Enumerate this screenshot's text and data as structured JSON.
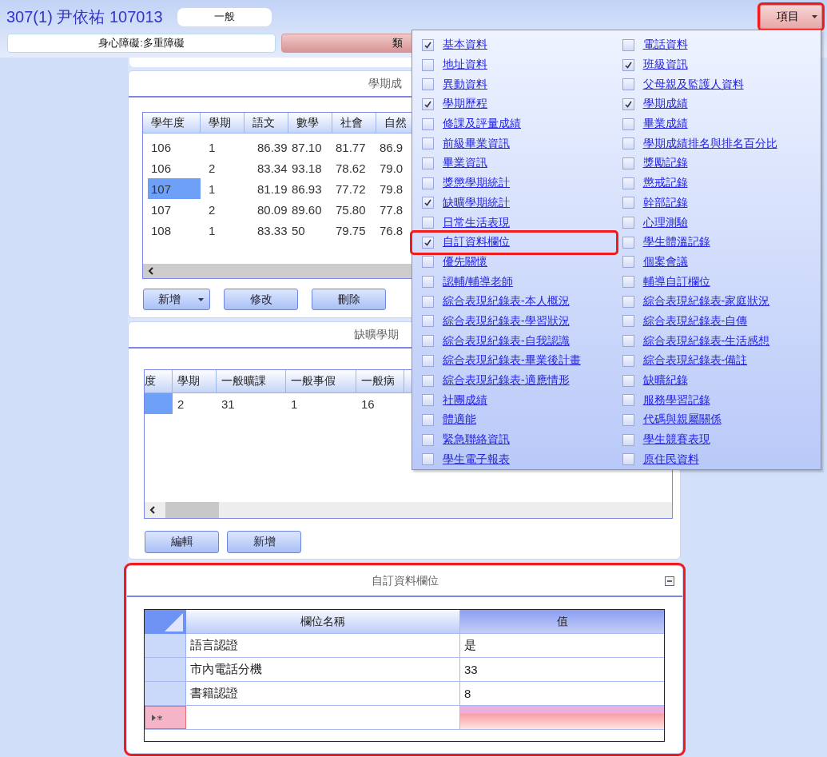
{
  "header": {
    "title": "307(1) 尹依祐 107013",
    "status_button": "一般",
    "disability_field": "身心障礙:多重障礙",
    "category_button": "類",
    "items_button": {
      "label": "項目",
      "highlighted": true
    }
  },
  "panels": [
    {
      "kind": "grid-table",
      "title": "學期成",
      "highlighted": false,
      "columns": [
        "學年度",
        "學期",
        "語文",
        "數學",
        "社會",
        "自然"
      ],
      "rows": [
        {
          "cells": [
            "106",
            "1",
            "86.39",
            "87.10",
            "81.77",
            "86.9"
          ],
          "selected": false
        },
        {
          "cells": [
            "106",
            "2",
            "83.34",
            "93.18",
            "78.62",
            "79.0"
          ],
          "selected": false
        },
        {
          "cells": [
            "107",
            "1",
            "81.19",
            "86.93",
            "77.72",
            "79.8"
          ],
          "selected": true
        },
        {
          "cells": [
            "107",
            "2",
            "80.09",
            "89.60",
            "75.80",
            "77.8"
          ],
          "selected": false
        },
        {
          "cells": [
            "108",
            "1",
            "83.33",
            "50",
            "79.75",
            "76.8"
          ],
          "selected": false
        }
      ],
      "buttons": [
        {
          "label": "新增",
          "dropdown": true
        },
        {
          "label": "修改",
          "dropdown": false
        },
        {
          "label": "刪除",
          "dropdown": false
        }
      ]
    },
    {
      "kind": "grid-table",
      "title": "缺曠學期",
      "highlighted": false,
      "columns": [
        "度",
        "學期",
        "一般曠課",
        "一般事假",
        "一般病"
      ],
      "rows": [
        {
          "cells": [
            "",
            "2",
            "31",
            "1",
            "16"
          ],
          "selected": true
        }
      ],
      "buttons": [
        {
          "label": "編輯",
          "dropdown": false
        },
        {
          "label": "新增",
          "dropdown": false
        }
      ]
    },
    {
      "kind": "field-grid",
      "title": "自訂資料欄位",
      "highlighted": true,
      "collapsible": true,
      "columns": [
        {
          "label": "欄位名稱",
          "selected": false
        },
        {
          "label": "值",
          "selected": true
        }
      ],
      "rows": [
        {
          "cells": [
            "語言認證",
            "是"
          ]
        },
        {
          "cells": [
            "市內電話分機",
            "33"
          ]
        },
        {
          "cells": [
            "書籍認證",
            "8"
          ]
        }
      ],
      "new_row": true
    }
  ],
  "menu": {
    "columns": [
      [
        {
          "label": "基本資料",
          "checked": true,
          "highlighted": false
        },
        {
          "label": "地址資料",
          "checked": false,
          "highlighted": false
        },
        {
          "label": "異動資料",
          "checked": false,
          "highlighted": false
        },
        {
          "label": "學期歷程",
          "checked": true,
          "highlighted": false
        },
        {
          "label": "修課及評量成績",
          "checked": false,
          "highlighted": false
        },
        {
          "label": "前級畢業資訊",
          "checked": false,
          "highlighted": false
        },
        {
          "label": "畢業資訊",
          "checked": false,
          "highlighted": false
        },
        {
          "label": "獎懲學期統計",
          "checked": false,
          "highlighted": false
        },
        {
          "label": "缺曠學期統計",
          "checked": true,
          "highlighted": false
        },
        {
          "label": "日常生活表現",
          "checked": false,
          "highlighted": false
        },
        {
          "label": "自訂資料欄位",
          "checked": true,
          "highlighted": true
        },
        {
          "label": "優先關懷",
          "checked": false,
          "highlighted": false
        },
        {
          "label": "認輔/輔導老師",
          "checked": false,
          "highlighted": false
        },
        {
          "label": "綜合表現紀錄表-本人概況",
          "checked": false,
          "highlighted": false
        },
        {
          "label": "綜合表現紀錄表-學習狀況",
          "checked": false,
          "highlighted": false
        },
        {
          "label": "綜合表現紀錄表-自我認識",
          "checked": false,
          "highlighted": false
        },
        {
          "label": "綜合表現紀錄表-畢業後計畫",
          "checked": false,
          "highlighted": false
        },
        {
          "label": "綜合表現紀錄表-適應情形",
          "checked": false,
          "highlighted": false
        },
        {
          "label": "社團成績",
          "checked": false,
          "highlighted": false
        },
        {
          "label": "體適能",
          "checked": false,
          "highlighted": false
        },
        {
          "label": "緊急聯絡資訊",
          "checked": false,
          "highlighted": false
        },
        {
          "label": "學生電子報表",
          "checked": false,
          "highlighted": false
        }
      ],
      [
        {
          "label": "電話資料",
          "checked": false,
          "highlighted": false
        },
        {
          "label": "班級資訊",
          "checked": true,
          "highlighted": false
        },
        {
          "label": "父母親及監護人資料",
          "checked": false,
          "highlighted": false
        },
        {
          "label": "學期成績",
          "checked": true,
          "highlighted": false
        },
        {
          "label": "畢業成績",
          "checked": false,
          "highlighted": false
        },
        {
          "label": "學期成績排名與排名百分比",
          "checked": false,
          "highlighted": false
        },
        {
          "label": "獎勵記錄",
          "checked": false,
          "highlighted": false
        },
        {
          "label": "懲戒記錄",
          "checked": false,
          "highlighted": false
        },
        {
          "label": "幹部記錄",
          "checked": false,
          "highlighted": false
        },
        {
          "label": "心理測驗",
          "checked": false,
          "highlighted": false
        },
        {
          "label": "學生體溫記錄",
          "checked": false,
          "highlighted": false
        },
        {
          "label": "個案會議",
          "checked": false,
          "highlighted": false
        },
        {
          "label": "輔導自訂欄位",
          "checked": false,
          "highlighted": false
        },
        {
          "label": "綜合表現紀錄表-家庭狀況",
          "checked": false,
          "highlighted": false
        },
        {
          "label": "綜合表現紀錄表-自傳",
          "checked": false,
          "highlighted": false
        },
        {
          "label": "綜合表現紀錄表-生活感想",
          "checked": false,
          "highlighted": false
        },
        {
          "label": "綜合表現紀錄表-備註",
          "checked": false,
          "highlighted": false
        },
        {
          "label": "缺曠紀錄",
          "checked": false,
          "highlighted": false
        },
        {
          "label": "服務學習記錄",
          "checked": false,
          "highlighted": false
        },
        {
          "label": "代碼與親屬關係",
          "checked": false,
          "highlighted": false
        },
        {
          "label": "學生競賽表現",
          "checked": false,
          "highlighted": false
        },
        {
          "label": "原住民資料",
          "checked": false,
          "highlighted": false
        }
      ]
    ]
  }
}
